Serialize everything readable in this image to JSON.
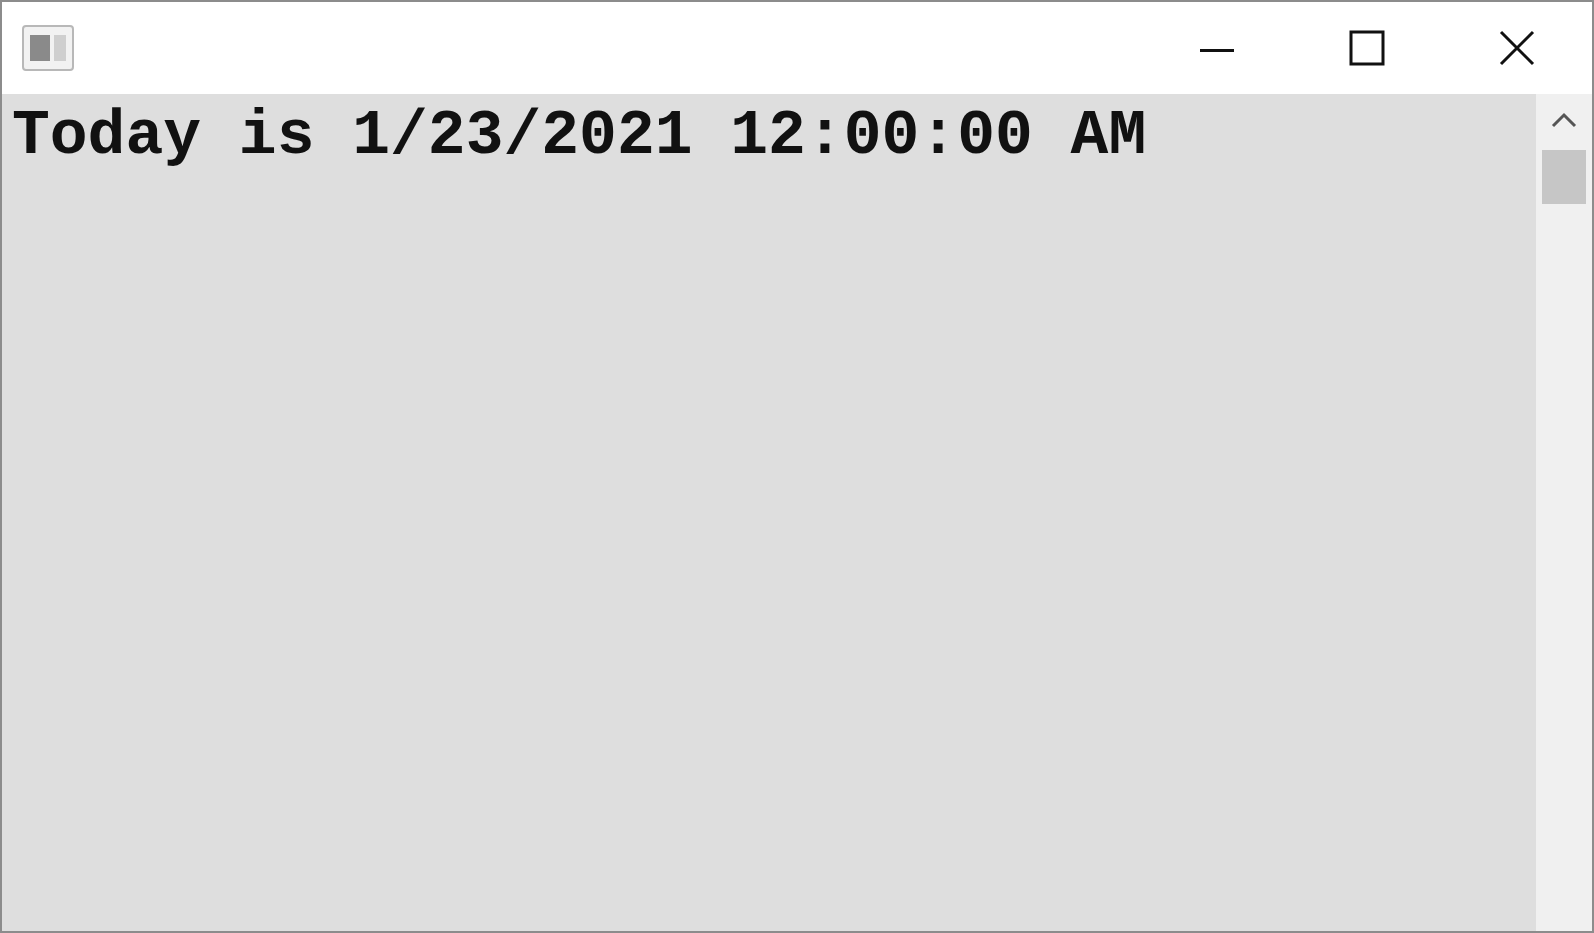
{
  "window": {
    "content_text": "Today is 1/23/2021 12:00:00 AM"
  }
}
